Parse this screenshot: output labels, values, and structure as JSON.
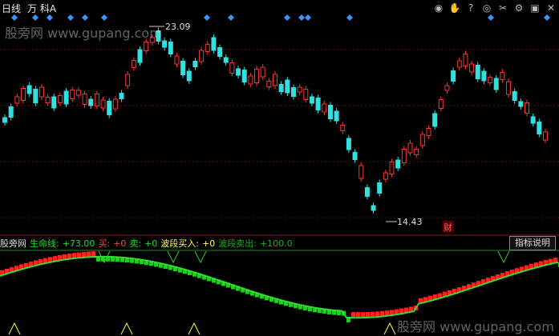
{
  "header": {
    "period": "日线",
    "stock": "万 科A",
    "toolbar_icons": [
      "eye-icon",
      "hand-icon",
      "help-icon",
      "scissors-icon",
      "settings-icon",
      "window-icon",
      "close-icon"
    ]
  },
  "watermarks": [
    "股旁网 www.gupang.com",
    "股旁网 www.gupang.com"
  ],
  "price_labels": {
    "high": "23.09",
    "low": "14.43",
    "marker": "财"
  },
  "indicator": {
    "name": "股旁网",
    "life_label": "生命线:",
    "life_value": "+73.00",
    "buy_label": "买:",
    "buy_value": "+0",
    "sell_label": "卖:",
    "sell_value": "+0",
    "wave_buy_label": "波段买入:",
    "wave_buy_value": "+0",
    "wave_sell_label": "波段卖出:",
    "wave_sell_value": "+100.0",
    "button_label": "指标说明"
  },
  "colors": {
    "up": "#ff3333",
    "down": "#33e0e0",
    "life_line": "#33dd33",
    "buy_text": "#ff4040",
    "sell_text": "#22dd22",
    "wave_buy_text": "#ffff55",
    "wave_sell_text": "#22aa22",
    "diamond": "#3399ff"
  }
}
